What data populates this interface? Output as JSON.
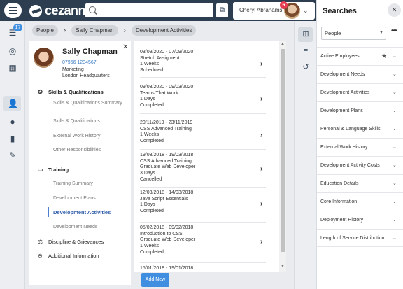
{
  "app": {
    "logo": "cezanne",
    "user_name": "Cheryl Abrahams",
    "notification_count": "6"
  },
  "nav": {
    "badge_count": "17"
  },
  "breadcrumb": [
    "People",
    "Sally Chapman",
    "Development Activities"
  ],
  "profile": {
    "name": "Sally Chapman",
    "phone": "07966 1234567",
    "department": "Marketing",
    "location": "London Headquarters"
  },
  "sections": {
    "skills": "Skills & Qualifications",
    "skills_items": [
      "Skills & Qualifications Summary",
      "Skills & Qualifications",
      "External Work History",
      "Other Responsibilities"
    ],
    "training": "Training",
    "training_items": [
      "Training Summary",
      "Development Plans",
      "Development Activities",
      "Development Needs"
    ],
    "discipline": "Discipline & Grievances",
    "additional": "Additional Information"
  },
  "activities": [
    {
      "dates": "03/09/2020 - 07/09/2020",
      "lines": [
        "Stretch Assigment",
        "1 Weeks",
        "Scheduled"
      ]
    },
    {
      "dates": "09/03/2020 - 09/03/2020",
      "lines": [
        "Teams That Work",
        "1 Days",
        "Completed"
      ]
    },
    {
      "dates": "20/11/2019 - 23/11/2019",
      "lines": [
        "CSS Advanced Training",
        "1 Weeks",
        "Completed"
      ]
    },
    {
      "dates": "19/03/2018 - 19/03/2018",
      "lines": [
        "CSS Advanced Training",
        "Graduate Web Developer",
        "3 Days",
        "Cancelled"
      ]
    },
    {
      "dates": "12/03/2018 - 14/03/2018",
      "lines": [
        "Java Script Essentials",
        "1 Days",
        "Completed"
      ]
    },
    {
      "dates": "05/02/2018 - 09/02/2018",
      "lines": [
        "Introduction to CSS",
        "Graduate Web Developer",
        "1 Weeks",
        "Completed"
      ]
    },
    {
      "dates": "15/01/2018 - 19/01/2018",
      "lines": []
    }
  ],
  "add_new": "Add New",
  "searches": {
    "title": "Searches",
    "select_value": "People",
    "items": [
      "Active Employees",
      "Development Needs",
      "Development Activities",
      "Development Plans",
      "Personal & Language Skills",
      "External Work History",
      "Development Activity Costs",
      "Education Details",
      "Core Information",
      "Deployment History",
      "Length of Service Distribution"
    ]
  }
}
